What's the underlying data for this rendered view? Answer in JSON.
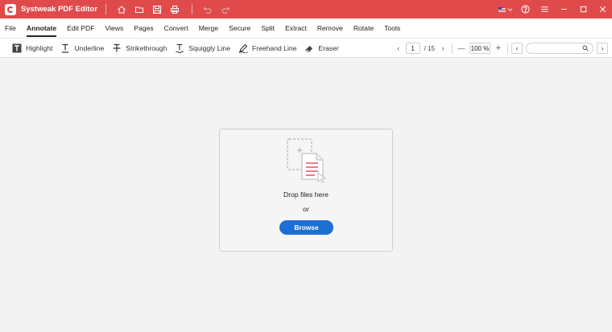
{
  "window": {
    "title": "Systweak PDF Editor"
  },
  "titlebar": {
    "quick_icons": [
      "home-icon",
      "folder-icon",
      "save-icon",
      "print-icon",
      "undo-icon",
      "redo-icon"
    ],
    "right_icons": [
      "flag-icon",
      "help-icon",
      "hamburger-icon",
      "minimize-icon",
      "maximize-icon",
      "close-icon"
    ]
  },
  "menu": {
    "items": [
      "File",
      "Annotate",
      "Edit PDF",
      "Views",
      "Pages",
      "Convert",
      "Merge",
      "Secure",
      "Split",
      "Extract",
      "Remove",
      "Rotate",
      "Tools"
    ],
    "active": "Annotate"
  },
  "toolbar": {
    "tools": [
      {
        "label": "Highlight",
        "icon": "highlight-icon"
      },
      {
        "label": "Underline",
        "icon": "underline-icon"
      },
      {
        "label": "Strikethrough",
        "icon": "strikethrough-icon"
      },
      {
        "label": "Squiggly Line",
        "icon": "squiggly-icon"
      },
      {
        "label": "Freehand Line",
        "icon": "pen-icon"
      },
      {
        "label": "Eraser",
        "icon": "eraser-icon"
      }
    ],
    "page_current": "1",
    "page_total": "/ 15",
    "zoom": "100 %",
    "search_placeholder": ""
  },
  "dropzone": {
    "title": "Drop files here",
    "or": "or",
    "browse_label": "Browse"
  },
  "colors": {
    "titlebar": "#e04a4a",
    "accent": "#1d6fd3",
    "doc_lines": "#e05561"
  }
}
